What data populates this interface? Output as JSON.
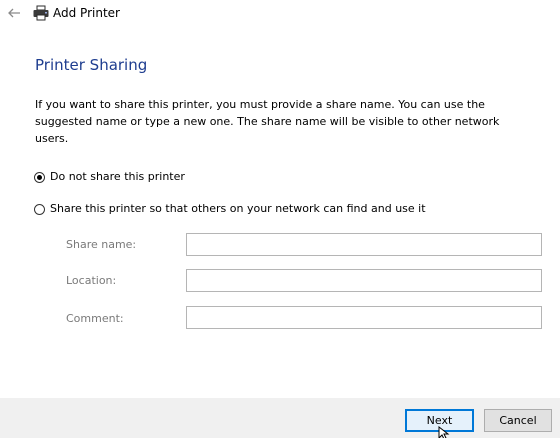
{
  "header": {
    "back_icon": "back-arrow-icon",
    "printer_icon": "printer-icon",
    "title": "Add Printer"
  },
  "main": {
    "heading": "Printer Sharing",
    "description": "If you want to share this printer, you must provide a share name. You can use the suggested name or type a new one. The share name will be visible to other network users.",
    "options": [
      {
        "label": "Do not share this printer",
        "selected": true
      },
      {
        "label": "Share this printer so that others on your network can find and use it",
        "selected": false
      }
    ],
    "fields": {
      "share_name": {
        "label": "Share name:",
        "value": ""
      },
      "location": {
        "label": "Location:",
        "value": ""
      },
      "comment": {
        "label": "Comment:",
        "value": ""
      }
    }
  },
  "footer": {
    "next_label": "Next",
    "cancel_label": "Cancel"
  },
  "colors": {
    "heading": "#1e3d8f",
    "focus_border": "#0078d7",
    "footer_bg": "#f0f0f0"
  }
}
